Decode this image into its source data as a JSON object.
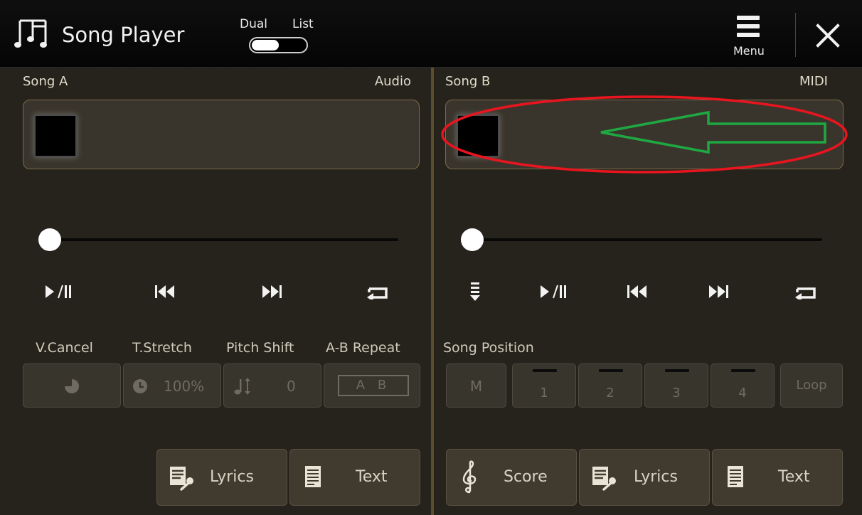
{
  "header": {
    "app_title": "Song Player",
    "dual_label": "Dual",
    "list_label": "List",
    "menu_label": "Menu",
    "close_icon": "close-icon"
  },
  "song_a": {
    "title": "Song A",
    "type": "Audio",
    "progress": 0,
    "func_labels": [
      "V.Cancel",
      "T.Stretch",
      "Pitch Shift",
      "A-B Repeat"
    ],
    "tstretch_value": "100%",
    "pitch_value": "0",
    "ab_label": "A B",
    "bottom_buttons": [
      "Lyrics",
      "Text"
    ]
  },
  "song_b": {
    "title": "Song B",
    "type": "MIDI",
    "progress": 0,
    "position_label": "Song Position",
    "position_buttons": [
      "M",
      "1",
      "2",
      "3",
      "4",
      "Loop"
    ],
    "bottom_buttons": [
      "Score",
      "Lyrics",
      "Text"
    ]
  },
  "annotations": {
    "highlight_color": "#e8151f",
    "arrow_color": "#1fa842"
  },
  "colors": {
    "panel_bg": "#26231c",
    "header_bg": "#0a0a0a",
    "accent_gold": "#7b6a48"
  }
}
